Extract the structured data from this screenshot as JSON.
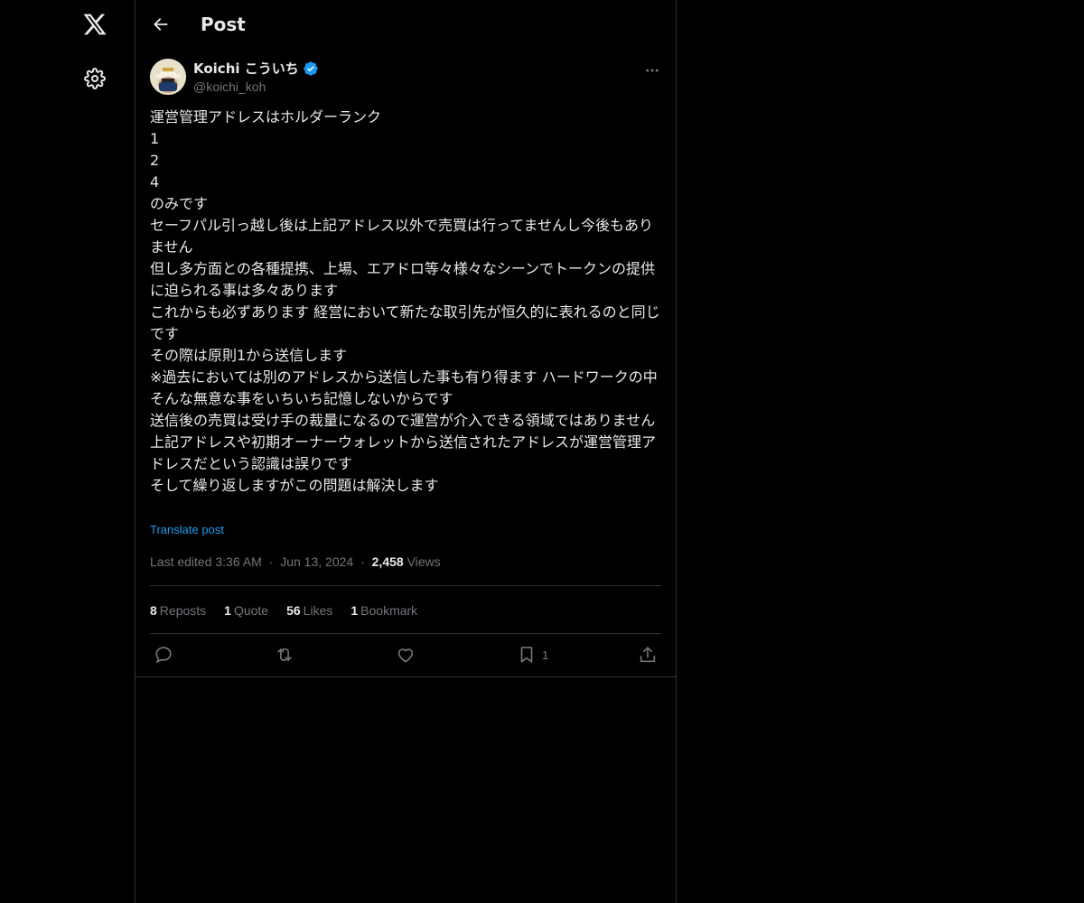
{
  "icons": {
    "logo": "x-logo-icon",
    "settings": "gear-icon",
    "back": "arrow-left-icon",
    "verified": "verified-badge-icon",
    "more": "more-horizontal-icon",
    "reply": "reply-icon",
    "repost": "repost-icon",
    "like": "heart-icon",
    "bookmark": "bookmark-icon",
    "share": "share-icon"
  },
  "colors": {
    "accent": "#1d9bf0",
    "background": "#000000",
    "secondary_text": "#71767b"
  },
  "header": {
    "title": "Post"
  },
  "post": {
    "author_name": "Koichi こういち",
    "handle": "@koichi_koh",
    "text": "運営管理アドレスはホルダーランク\n1\n2\n4\nのみです\nセーフパル引っ越し後は上記アドレス以外で売買は行ってませんし今後もありません\n但し多方面との各種提携、上場、エアドロ等々様々なシーンでトークンの提供に迫られる事は多々あります\nこれからも必ずあります 経営において新たな取引先が恒久的に表れるのと同じです\nその際は原則1から送信します\n※過去においては別のアドレスから送信した事も有り得ます ハードワークの中そんな無意な事をいちいち記憶しないからです\n送信後の売買は受け手の裁量になるので運営が介入できる領域ではありません\n上記アドレスや初期オーナーウォレットから送信されたアドレスが運営管理アドレスだという認識は誤りです\nそして繰り返しますがこの問題は解決します",
    "translate_label": "Translate post",
    "edited_label": "Last edited 3:36 AM",
    "dot": "·",
    "date": "Jun 13, 2024",
    "views_count": "2,458",
    "views_label": "Views"
  },
  "stats": [
    {
      "count": "8",
      "label": "Reposts"
    },
    {
      "count": "1",
      "label": "Quote"
    },
    {
      "count": "56",
      "label": "Likes"
    },
    {
      "count": "1",
      "label": "Bookmark"
    }
  ],
  "actions": {
    "bookmark_count": "1"
  }
}
